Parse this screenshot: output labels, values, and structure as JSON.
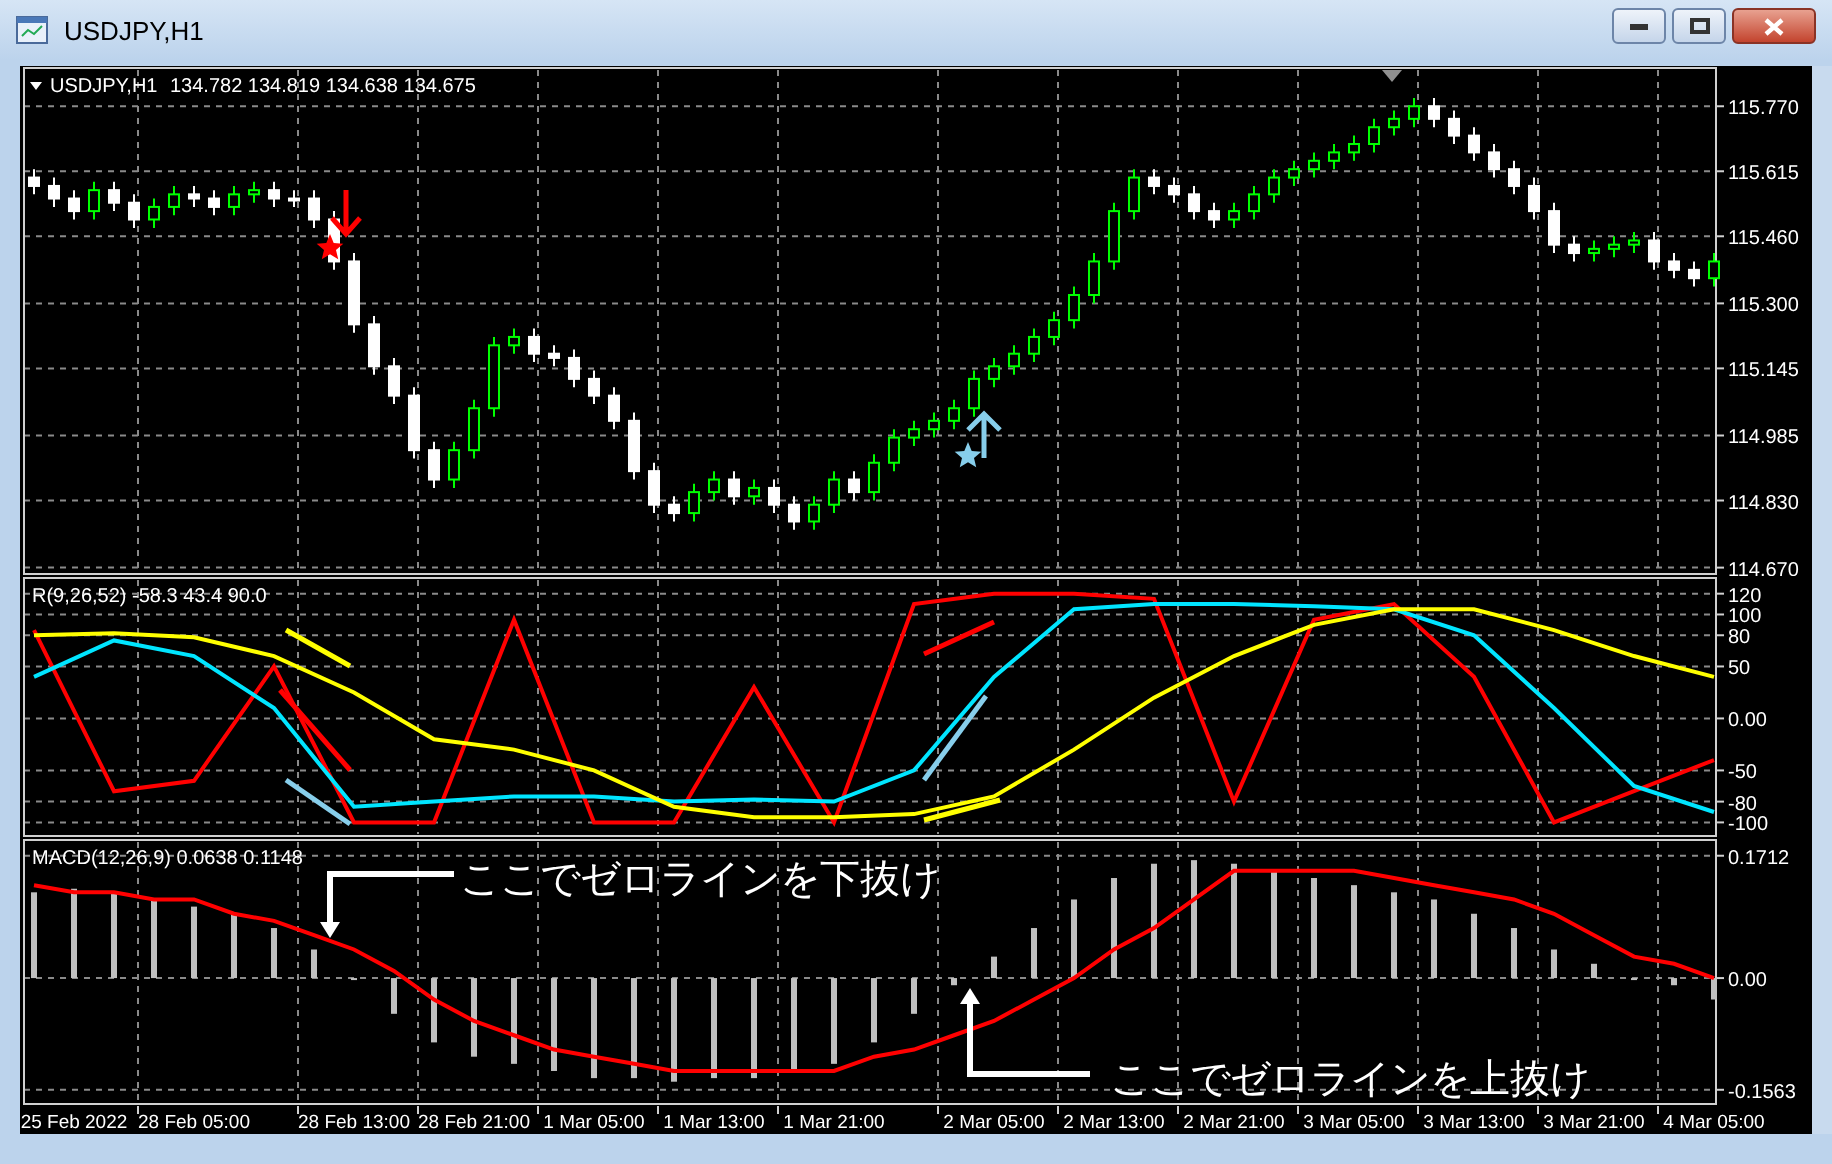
{
  "window": {
    "title": "USDJPY,H1"
  },
  "price_panel": {
    "symbol": "USDJPY,H1",
    "ohlc": "134.782 134.819 134.638 134.675",
    "chart_data": {
      "type": "candlestick",
      "grid": true,
      "ylim": [
        114.65,
        115.866
      ],
      "categories": [
        null,
        null,
        null,
        null,
        null,
        null,
        null,
        null,
        null,
        null,
        null,
        null,
        null,
        null,
        null,
        null,
        null,
        null,
        null,
        null,
        null,
        null,
        null,
        null,
        null,
        null,
        null,
        null,
        null,
        null,
        null,
        null,
        null,
        null,
        null,
        null,
        null,
        null,
        null,
        null,
        null,
        null,
        null,
        null,
        null,
        null,
        null,
        null,
        null,
        null,
        null,
        null,
        null,
        null,
        null,
        null,
        null,
        null,
        null,
        null,
        null,
        null,
        null,
        null,
        null,
        null,
        null,
        null,
        null,
        null,
        null,
        null,
        null,
        null,
        null,
        null,
        null,
        null,
        null,
        null,
        null,
        null,
        null,
        null,
        null
      ],
      "ohlc": [
        [
          115.6,
          115.62,
          115.56,
          115.58
        ],
        [
          115.58,
          115.6,
          115.53,
          115.55
        ],
        [
          115.55,
          115.57,
          115.5,
          115.52
        ],
        [
          115.52,
          115.59,
          115.5,
          115.57
        ],
        [
          115.57,
          115.59,
          115.52,
          115.54
        ],
        [
          115.54,
          115.56,
          115.48,
          115.5
        ],
        [
          115.5,
          115.55,
          115.48,
          115.53
        ],
        [
          115.53,
          115.58,
          115.51,
          115.56
        ],
        [
          115.56,
          115.58,
          115.53,
          115.55
        ],
        [
          115.55,
          115.57,
          115.51,
          115.53
        ],
        [
          115.53,
          115.58,
          115.51,
          115.56
        ],
        [
          115.56,
          115.59,
          115.54,
          115.57
        ],
        [
          115.57,
          115.59,
          115.53,
          115.55
        ],
        [
          115.55,
          115.57,
          115.53,
          115.55
        ],
        [
          115.55,
          115.57,
          115.48,
          115.5
        ],
        [
          115.5,
          115.52,
          115.38,
          115.4
        ],
        [
          115.4,
          115.42,
          115.23,
          115.25
        ],
        [
          115.25,
          115.27,
          115.13,
          115.15
        ],
        [
          115.15,
          115.17,
          115.06,
          115.08
        ],
        [
          115.08,
          115.1,
          114.93,
          114.95
        ],
        [
          114.95,
          114.97,
          114.86,
          114.88
        ],
        [
          114.88,
          114.97,
          114.86,
          114.95
        ],
        [
          114.95,
          115.07,
          114.93,
          115.05
        ],
        [
          115.05,
          115.22,
          115.03,
          115.2
        ],
        [
          115.2,
          115.24,
          115.18,
          115.22
        ],
        [
          115.22,
          115.24,
          115.16,
          115.18
        ],
        [
          115.18,
          115.2,
          115.15,
          115.17
        ],
        [
          115.17,
          115.19,
          115.1,
          115.12
        ],
        [
          115.12,
          115.14,
          115.06,
          115.08
        ],
        [
          115.08,
          115.1,
          115.0,
          115.02
        ],
        [
          115.02,
          115.04,
          114.88,
          114.9
        ],
        [
          114.9,
          114.92,
          114.8,
          114.82
        ],
        [
          114.82,
          114.84,
          114.78,
          114.8
        ],
        [
          114.8,
          114.87,
          114.78,
          114.85
        ],
        [
          114.85,
          114.9,
          114.83,
          114.88
        ],
        [
          114.88,
          114.9,
          114.82,
          114.84
        ],
        [
          114.84,
          114.88,
          114.82,
          114.86
        ],
        [
          114.86,
          114.88,
          114.8,
          114.82
        ],
        [
          114.82,
          114.84,
          114.76,
          114.78
        ],
        [
          114.78,
          114.84,
          114.76,
          114.82
        ],
        [
          114.82,
          114.9,
          114.8,
          114.88
        ],
        [
          114.88,
          114.9,
          114.83,
          114.85
        ],
        [
          114.85,
          114.94,
          114.83,
          114.92
        ],
        [
          114.92,
          115.0,
          114.9,
          114.98
        ],
        [
          114.98,
          115.02,
          114.96,
          115.0
        ],
        [
          115.0,
          115.04,
          114.98,
          115.02
        ],
        [
          115.02,
          115.07,
          115.0,
          115.05
        ],
        [
          115.05,
          115.14,
          115.03,
          115.12
        ],
        [
          115.12,
          115.17,
          115.1,
          115.15
        ],
        [
          115.15,
          115.2,
          115.13,
          115.18
        ],
        [
          115.18,
          115.24,
          115.16,
          115.22
        ],
        [
          115.22,
          115.28,
          115.2,
          115.26
        ],
        [
          115.26,
          115.34,
          115.24,
          115.32
        ],
        [
          115.32,
          115.42,
          115.3,
          115.4
        ],
        [
          115.4,
          115.54,
          115.38,
          115.52
        ],
        [
          115.52,
          115.62,
          115.5,
          115.6
        ],
        [
          115.6,
          115.62,
          115.56,
          115.58
        ],
        [
          115.58,
          115.6,
          115.54,
          115.56
        ],
        [
          115.56,
          115.58,
          115.5,
          115.52
        ],
        [
          115.52,
          115.54,
          115.48,
          115.5
        ],
        [
          115.5,
          115.54,
          115.48,
          115.52
        ],
        [
          115.52,
          115.58,
          115.5,
          115.56
        ],
        [
          115.56,
          115.62,
          115.54,
          115.6
        ],
        [
          115.6,
          115.64,
          115.58,
          115.62
        ],
        [
          115.62,
          115.66,
          115.6,
          115.64
        ],
        [
          115.64,
          115.68,
          115.62,
          115.66
        ],
        [
          115.66,
          115.7,
          115.64,
          115.68
        ],
        [
          115.68,
          115.74,
          115.66,
          115.72
        ],
        [
          115.72,
          115.76,
          115.7,
          115.74
        ],
        [
          115.74,
          115.79,
          115.72,
          115.77
        ],
        [
          115.77,
          115.79,
          115.72,
          115.74
        ],
        [
          115.74,
          115.76,
          115.68,
          115.7
        ],
        [
          115.7,
          115.72,
          115.64,
          115.66
        ],
        [
          115.66,
          115.68,
          115.6,
          115.62
        ],
        [
          115.62,
          115.64,
          115.56,
          115.58
        ],
        [
          115.58,
          115.6,
          115.5,
          115.52
        ],
        [
          115.52,
          115.54,
          115.42,
          115.44
        ],
        [
          115.44,
          115.46,
          115.4,
          115.42
        ],
        [
          115.42,
          115.45,
          115.4,
          115.43
        ],
        [
          115.43,
          115.46,
          115.41,
          115.44
        ],
        [
          115.44,
          115.47,
          115.42,
          115.45
        ],
        [
          115.45,
          115.47,
          115.38,
          115.4
        ],
        [
          115.4,
          115.42,
          115.36,
          115.38
        ],
        [
          115.38,
          115.4,
          115.34,
          115.36
        ],
        [
          115.36,
          115.42,
          115.34,
          115.4
        ]
      ],
      "yticks": [
        {
          "value": 115.77,
          "label": "115.770"
        },
        {
          "value": 115.615,
          "label": "115.615"
        },
        {
          "value": 115.46,
          "label": "115.460"
        },
        {
          "value": 115.3,
          "label": "115.300"
        },
        {
          "value": 115.145,
          "label": "115.145"
        },
        {
          "value": 114.985,
          "label": "114.985"
        },
        {
          "value": 114.83,
          "label": "114.830"
        },
        {
          "value": 114.67,
          "label": "114.670"
        }
      ]
    },
    "markers": [
      {
        "kind": "arrow_down",
        "color": "#ff0000"
      },
      {
        "kind": "star",
        "color": "#ff0000"
      },
      {
        "kind": "arrow_up",
        "color": "#87ceeb"
      },
      {
        "kind": "star",
        "color": "#87ceeb"
      }
    ]
  },
  "indicator_panel": {
    "label": "R(9,26,52) -58.3 43.4 90.0",
    "chart_data": {
      "type": "line",
      "grid": true,
      "ylim": [
        -115,
        137
      ],
      "series": [
        {
          "color": "#ff0000",
          "values": [
            85,
            -70,
            -60,
            50,
            -100,
            -100,
            95,
            -100,
            -100,
            30,
            -100,
            110,
            120,
            120,
            115,
            -80,
            95,
            110,
            40,
            -100,
            -70,
            -40
          ]
        },
        {
          "color": "#00e5ff",
          "values": [
            40,
            75,
            60,
            10,
            -85,
            -80,
            -75,
            -75,
            -80,
            -78,
            -80,
            -50,
            40,
            105,
            110,
            110,
            108,
            105,
            80,
            10,
            -65,
            -90
          ]
        },
        {
          "color": "#ffff00",
          "values": [
            80,
            82,
            78,
            60,
            25,
            -20,
            -30,
            -50,
            -85,
            -95,
            -95,
            -92,
            -75,
            -30,
            20,
            60,
            90,
            105,
            105,
            85,
            60,
            40
          ]
        }
      ],
      "yticks": [
        120,
        100,
        80,
        50,
        {
          "value": 0,
          "label": "0.00"
        },
        -50,
        -80,
        -100
      ]
    },
    "trend_lines": [
      {
        "color": "#ffff00"
      },
      {
        "color": "#ff0000"
      },
      {
        "color": "#87ceeb"
      },
      {
        "color": "#ff0000"
      },
      {
        "color": "#87ceeb"
      },
      {
        "color": "#ffff00"
      }
    ]
  },
  "macd_panel": {
    "label": "MACD(12,26,9) 0.0638 0.1148",
    "chart_data": {
      "type": "bar",
      "grid": true,
      "ylim": [
        -0.179,
        0.196
      ],
      "categories": [
        null,
        "25 Feb 2022",
        null,
        null,
        "28 Feb 05:00",
        null,
        null,
        null,
        "28 Feb 13:00",
        null,
        null,
        "28 Feb 21:00",
        null,
        null,
        "1 Mar 05:00",
        null,
        null,
        "1 Mar 13:00",
        null,
        null,
        "1 Mar 21:00",
        null,
        null,
        null,
        "2 Mar 05:00",
        null,
        null,
        "2 Mar 13:00",
        null,
        null,
        "2 Mar 21:00",
        null,
        null,
        "3 Mar 05:00",
        null,
        null,
        "3 Mar 13:00",
        null,
        null,
        "3 Mar 21:00",
        null,
        null,
        "4 Mar 05:00"
      ],
      "series": [
        {
          "type": "bar",
          "color": "#c0c0c0",
          "values": [
            0.12,
            0.125,
            0.12,
            0.11,
            0.1,
            0.09,
            0.07,
            0.04,
            0.0,
            -0.05,
            -0.09,
            -0.11,
            -0.12,
            -0.13,
            -0.14,
            -0.14,
            -0.145,
            -0.14,
            -0.14,
            -0.13,
            -0.12,
            -0.09,
            -0.05,
            -0.01,
            0.03,
            0.07,
            0.11,
            0.14,
            0.16,
            0.165,
            0.16,
            0.15,
            0.14,
            0.13,
            0.12,
            0.11,
            0.09,
            0.07,
            0.04,
            0.02,
            0.0,
            -0.01,
            -0.03
          ]
        },
        {
          "type": "line",
          "color": "#ff0000",
          "values": [
            0.13,
            0.12,
            0.12,
            0.11,
            0.11,
            0.09,
            0.08,
            0.06,
            0.04,
            0.01,
            -0.03,
            -0.06,
            -0.08,
            -0.1,
            -0.11,
            -0.12,
            -0.13,
            -0.13,
            -0.13,
            -0.13,
            -0.13,
            -0.11,
            -0.1,
            -0.08,
            -0.06,
            -0.03,
            0.0,
            0.04,
            0.07,
            0.11,
            0.15,
            0.15,
            0.15,
            0.15,
            0.14,
            0.13,
            0.12,
            0.11,
            0.09,
            0.06,
            0.03,
            0.02,
            0.0
          ]
        }
      ],
      "yticks": [
        {
          "value": 0.1712,
          "label": "0.1712"
        },
        {
          "value": 0,
          "label": "0.00"
        },
        {
          "value": -0.1563,
          "label": "-0.1563"
        }
      ]
    },
    "callouts": [
      {
        "text": "ここでゼロラインを下抜け"
      },
      {
        "text": "ここでゼロラインを上抜け"
      }
    ]
  }
}
